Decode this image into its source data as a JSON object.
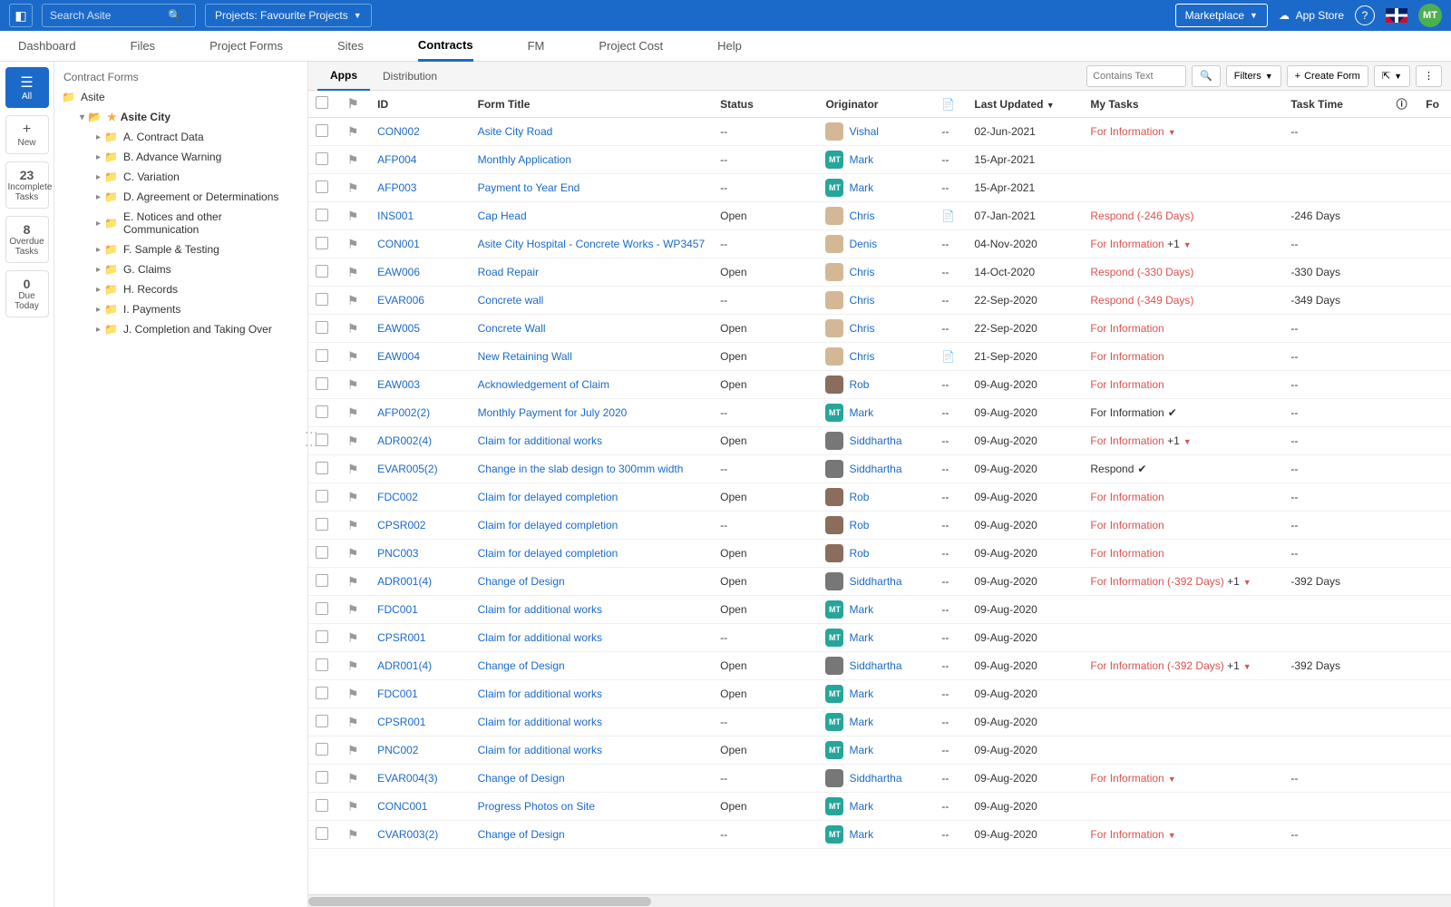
{
  "topbar": {
    "search_placeholder": "Search Asite",
    "project_selector": "Projects: Favourite Projects",
    "marketplace": "Marketplace",
    "app_store": "App Store",
    "user_initials": "MT"
  },
  "nav": [
    "Dashboard",
    "Files",
    "Project Forms",
    "Sites",
    "Contracts",
    "FM",
    "Project Cost",
    "Help"
  ],
  "nav_active_index": 4,
  "rail": [
    {
      "label": "All",
      "icon": "list"
    },
    {
      "label": "New",
      "icon": "plus"
    },
    {
      "count": "23",
      "label": "Incomplete Tasks"
    },
    {
      "count": "8",
      "label": "Overdue Tasks"
    },
    {
      "count": "0",
      "label": "Due Today"
    }
  ],
  "tree": {
    "title": "Contract Forms",
    "root": "Asite",
    "selected": "Asite City",
    "children": [
      "A. Contract Data",
      "B. Advance Warning",
      "C. Variation",
      "D. Agreement or Determinations",
      "E. Notices and other Communication",
      "F. Sample & Testing",
      "G. Claims",
      "H. Records",
      "I. Payments",
      "J. Completion and Taking Over"
    ]
  },
  "subtabs": [
    "Apps",
    "Distribution"
  ],
  "toolbar": {
    "contains_placeholder": "Contains Text",
    "filters": "Filters",
    "create": "Create Form"
  },
  "columns": [
    "",
    "",
    "ID",
    "Form Title",
    "Status",
    "Originator",
    "",
    "Last Updated",
    "My Tasks",
    "Task Time",
    "",
    "Fo"
  ],
  "rows": [
    {
      "id": "CON002",
      "title": "Asite City Road",
      "status": "--",
      "orig": "Vishal",
      "av": "person",
      "doc": "--",
      "date": "02-Jun-2021",
      "task": "For Information",
      "task_red": true,
      "task_caret": true,
      "time": "--"
    },
    {
      "id": "AFP004",
      "title": "Monthly Application",
      "status": "--",
      "orig": "Mark",
      "av": "teal",
      "doc": "--",
      "date": "15-Apr-2021",
      "task": "",
      "time": ""
    },
    {
      "id": "AFP003",
      "title": "Payment to Year End",
      "status": "--",
      "orig": "Mark",
      "av": "teal",
      "doc": "--",
      "date": "15-Apr-2021",
      "task": "",
      "time": ""
    },
    {
      "id": "INS001",
      "title": "Cap Head",
      "status": "Open",
      "orig": "Chris",
      "av": "person",
      "doc": "doc",
      "date": "07-Jan-2021",
      "task": "Respond (-246 Days)",
      "task_red": true,
      "time": "-246 Days"
    },
    {
      "id": "CON001",
      "title": "Asite City Hospital - Concrete Works - WP3457",
      "status": "--",
      "orig": "Denis",
      "av": "person",
      "doc": "--",
      "date": "04-Nov-2020",
      "task": "For Information",
      "task_red": true,
      "task_plus": "+1",
      "task_caret": true,
      "time": "--"
    },
    {
      "id": "EAW006",
      "title": "Road Repair",
      "status": "Open",
      "orig": "Chris",
      "av": "person",
      "doc": "--",
      "date": "14-Oct-2020",
      "task": "Respond (-330 Days)",
      "task_red": true,
      "time": "-330 Days"
    },
    {
      "id": "EVAR006",
      "title": "Concrete wall",
      "status": "--",
      "orig": "Chris",
      "av": "person",
      "doc": "--",
      "date": "22-Sep-2020",
      "task": "Respond (-349 Days)",
      "task_red": true,
      "time": "-349 Days"
    },
    {
      "id": "EAW005",
      "title": "Concrete Wall",
      "status": "Open",
      "orig": "Chris",
      "av": "person",
      "doc": "--",
      "date": "22-Sep-2020",
      "task": "For Information",
      "task_red": true,
      "time": "--"
    },
    {
      "id": "EAW004",
      "title": "New Retaining Wall",
      "status": "Open",
      "orig": "Chris",
      "av": "person",
      "doc": "doc",
      "date": "21-Sep-2020",
      "task": "For Information",
      "task_red": true,
      "time": "--"
    },
    {
      "id": "EAW003",
      "title": "Acknowledgement of Claim",
      "status": "Open",
      "orig": "Rob",
      "av": "person2",
      "doc": "--",
      "date": "09-Aug-2020",
      "task": "For Information",
      "task_red": true,
      "time": "--"
    },
    {
      "id": "AFP002(2)",
      "title": "Monthly Payment for July 2020",
      "status": "--",
      "orig": "Mark",
      "av": "teal",
      "doc": "--",
      "date": "09-Aug-2020",
      "task": "For Information",
      "task_check": true,
      "time": "--"
    },
    {
      "id": "ADR002(4)",
      "title": "Claim for additional works",
      "status": "Open",
      "orig": "Siddhartha",
      "av": "gray",
      "doc": "--",
      "date": "09-Aug-2020",
      "task": "For Information",
      "task_red": true,
      "task_plus": "+1",
      "task_caret": true,
      "time": "--"
    },
    {
      "id": "EVAR005(2)",
      "title": "Change in the slab design to 300mm width",
      "status": "--",
      "orig": "Siddhartha",
      "av": "gray",
      "doc": "--",
      "date": "09-Aug-2020",
      "task": "Respond",
      "task_check": true,
      "time": "--"
    },
    {
      "id": "FDC002",
      "title": "Claim for delayed completion",
      "status": "Open",
      "orig": "Rob",
      "av": "person2",
      "doc": "--",
      "date": "09-Aug-2020",
      "task": "For Information",
      "task_red": true,
      "time": "--"
    },
    {
      "id": "CPSR002",
      "title": "Claim for delayed completion",
      "status": "--",
      "orig": "Rob",
      "av": "person2",
      "doc": "--",
      "date": "09-Aug-2020",
      "task": "For Information",
      "task_red": true,
      "time": "--"
    },
    {
      "id": "PNC003",
      "title": "Claim for delayed completion",
      "status": "Open",
      "orig": "Rob",
      "av": "person2",
      "doc": "--",
      "date": "09-Aug-2020",
      "task": "For Information",
      "task_red": true,
      "time": "--"
    },
    {
      "id": "ADR001(4)",
      "title": "Change of Design",
      "status": "Open",
      "orig": "Siddhartha",
      "av": "gray",
      "doc": "--",
      "date": "09-Aug-2020",
      "task": "For Information (-392 Days)",
      "task_red": true,
      "task_plus": "+1",
      "task_caret": true,
      "time": "-392 Days"
    },
    {
      "id": "FDC001",
      "title": "Claim for additional works",
      "status": "Open",
      "orig": "Mark",
      "av": "teal",
      "doc": "--",
      "date": "09-Aug-2020",
      "task": "",
      "time": ""
    },
    {
      "id": "CPSR001",
      "title": "Claim for additional works",
      "status": "--",
      "orig": "Mark",
      "av": "teal",
      "doc": "--",
      "date": "09-Aug-2020",
      "task": "",
      "time": ""
    },
    {
      "id": "ADR001(4)",
      "title": "Change of Design",
      "status": "Open",
      "orig": "Siddhartha",
      "av": "gray",
      "doc": "--",
      "date": "09-Aug-2020",
      "task": "For Information (-392 Days)",
      "task_red": true,
      "task_plus": "+1",
      "task_caret": true,
      "time": "-392 Days"
    },
    {
      "id": "FDC001",
      "title": "Claim for additional works",
      "status": "Open",
      "orig": "Mark",
      "av": "teal",
      "doc": "--",
      "date": "09-Aug-2020",
      "task": "",
      "time": ""
    },
    {
      "id": "CPSR001",
      "title": "Claim for additional works",
      "status": "--",
      "orig": "Mark",
      "av": "teal",
      "doc": "--",
      "date": "09-Aug-2020",
      "task": "",
      "time": ""
    },
    {
      "id": "PNC002",
      "title": "Claim for additional works",
      "status": "Open",
      "orig": "Mark",
      "av": "teal",
      "doc": "--",
      "date": "09-Aug-2020",
      "task": "",
      "time": ""
    },
    {
      "id": "EVAR004(3)",
      "title": "Change of Design",
      "status": "--",
      "orig": "Siddhartha",
      "av": "gray",
      "doc": "--",
      "date": "09-Aug-2020",
      "task": "For Information",
      "task_red": true,
      "task_caret": true,
      "time": "--"
    },
    {
      "id": "CONC001",
      "title": "Progress Photos on Site",
      "status": "Open",
      "orig": "Mark",
      "av": "teal",
      "doc": "--",
      "date": "09-Aug-2020",
      "task": "",
      "time": ""
    },
    {
      "id": "CVAR003(2)",
      "title": "Change of Design",
      "status": "--",
      "orig": "Mark",
      "av": "teal",
      "doc": "--",
      "date": "09-Aug-2020",
      "task": "For Information",
      "task_red": true,
      "task_caret": true,
      "time": "--"
    }
  ]
}
